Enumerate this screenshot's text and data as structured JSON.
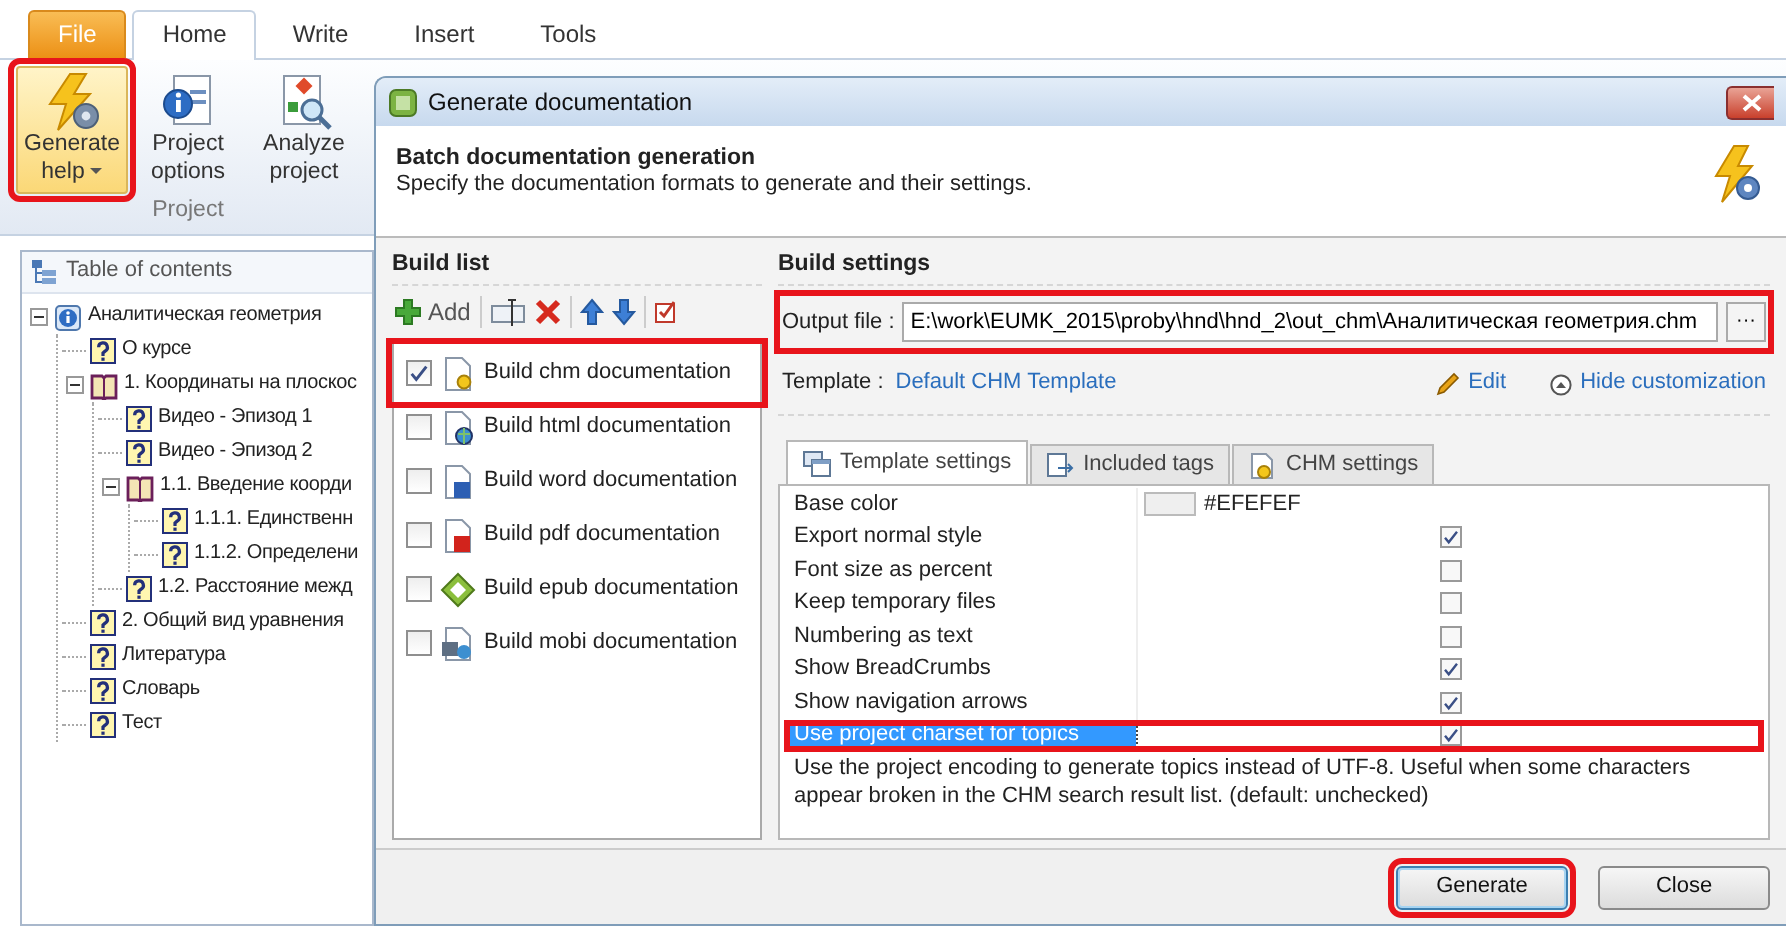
{
  "ribbon": {
    "tabs": [
      {
        "label": "File",
        "kind": "file",
        "selected": false
      },
      {
        "label": "Home",
        "kind": "tab",
        "selected": true
      },
      {
        "label": "Write",
        "kind": "tab",
        "selected": false
      },
      {
        "label": "Insert",
        "kind": "tab",
        "selected": false
      },
      {
        "label": "Tools",
        "kind": "tab",
        "selected": false
      }
    ],
    "group": "Project",
    "buttons": [
      {
        "label": "Generate help",
        "kind": "generate",
        "dropdown": true,
        "highlighted": true
      },
      {
        "label": "Project options",
        "kind": "options",
        "dropdown": false,
        "highlighted": false
      },
      {
        "label": "Analyze project",
        "kind": "analyze",
        "dropdown": false,
        "highlighted": false
      }
    ]
  },
  "toc": {
    "title": "Table of contents",
    "items": [
      {
        "label": "Аналитическая геометрия",
        "kind": "project",
        "expanded": true,
        "children": [
          {
            "label": "О курсе",
            "kind": "topic"
          },
          {
            "label": "1. Координаты на плоскос",
            "kind": "book",
            "expanded": true,
            "children": [
              {
                "label": "Видео - Эпизод 1",
                "kind": "topic"
              },
              {
                "label": "Видео - Эпизод 2",
                "kind": "topic"
              },
              {
                "label": "1.1. Введение коорди",
                "kind": "book",
                "expanded": true,
                "children": [
                  {
                    "label": "1.1.1. Единственн",
                    "kind": "topic"
                  },
                  {
                    "label": "1.1.2. Определени",
                    "kind": "topic"
                  }
                ]
              },
              {
                "label": "1.2. Расстояние межд",
                "kind": "topic"
              }
            ]
          },
          {
            "label": "2. Общий вид уравнения",
            "kind": "topic"
          },
          {
            "label": "Литература",
            "kind": "topic"
          },
          {
            "label": "Словарь",
            "kind": "topic"
          },
          {
            "label": "Тест",
            "kind": "topic"
          }
        ]
      }
    ]
  },
  "dialog": {
    "title": "Generate documentation",
    "heading": "Batch documentation generation",
    "subheading": "Specify the documentation formats to generate and their settings.",
    "build_list": {
      "title": "Build list",
      "add_label": "Add",
      "items": [
        {
          "label": "Build chm documentation",
          "kind": "chm",
          "checked": true,
          "highlighted": true
        },
        {
          "label": "Build html documentation",
          "kind": "html",
          "checked": false,
          "highlighted": false
        },
        {
          "label": "Build word documentation",
          "kind": "word",
          "checked": false,
          "highlighted": false
        },
        {
          "label": "Build pdf documentation",
          "kind": "pdf",
          "checked": false,
          "highlighted": false
        },
        {
          "label": "Build epub documentation",
          "kind": "epub",
          "checked": false,
          "highlighted": false
        },
        {
          "label": "Build mobi documentation",
          "kind": "mobi",
          "checked": false,
          "highlighted": false
        }
      ]
    },
    "settings": {
      "title": "Build settings",
      "output_label": "Output file :",
      "output_value": "E:\\work\\EUMK_2015\\proby\\hnd\\hnd_2\\out_chm\\Аналитическая геометрия.chm",
      "browse": "···",
      "output_highlighted": true,
      "template_label": "Template :",
      "template_link": "Default CHM Template",
      "edit": "Edit",
      "hide": "Hide customization",
      "tabs": [
        {
          "label": "Template settings",
          "kind": "template",
          "selected": true
        },
        {
          "label": "Included tags",
          "kind": "tags",
          "selected": false
        },
        {
          "label": "CHM settings",
          "kind": "chm",
          "selected": false
        }
      ],
      "rows": [
        {
          "name": "Base color",
          "kind": "color",
          "value": "#EFEFEF",
          "selected": false,
          "highlighted": false
        },
        {
          "name": "Export normal style",
          "kind": "check",
          "checked": true,
          "selected": false,
          "highlighted": false
        },
        {
          "name": "Font size as percent",
          "kind": "check",
          "checked": false,
          "selected": false,
          "highlighted": false
        },
        {
          "name": "Keep temporary files",
          "kind": "check",
          "checked": false,
          "selected": false,
          "highlighted": false
        },
        {
          "name": "Numbering as text",
          "kind": "check",
          "checked": false,
          "selected": false,
          "highlighted": false
        },
        {
          "name": "Show BreadCrumbs",
          "kind": "check",
          "checked": true,
          "selected": false,
          "highlighted": false
        },
        {
          "name": "Show navigation arrows",
          "kind": "check",
          "checked": true,
          "selected": false,
          "highlighted": false
        },
        {
          "name": "Use project charset for topics",
          "kind": "check",
          "checked": true,
          "selected": true,
          "highlighted": true
        }
      ],
      "description": "Use the project encoding to generate topics instead of UTF-8. Useful when some characters appear broken in the CHM search result list. (default: unchecked)"
    },
    "buttons": [
      {
        "label": "Generate",
        "default": true,
        "highlighted": true
      },
      {
        "label": "Close",
        "default": false,
        "highlighted": false
      }
    ]
  }
}
